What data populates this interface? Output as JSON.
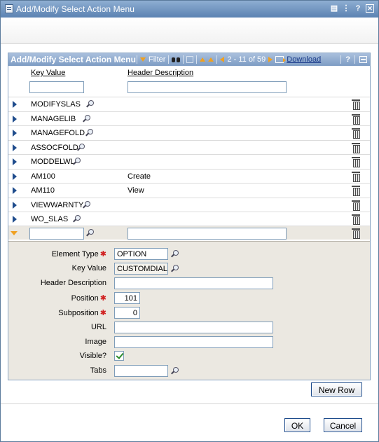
{
  "window": {
    "title": "Add/Modify Select Action Menu",
    "controls": [
      "▤",
      "⋮",
      "?",
      "✕"
    ]
  },
  "panel": {
    "title": "Add/Modify Select Action Menu",
    "filter_label": "Filter",
    "range_text": "2 - 11 of 59",
    "download_label": "Download",
    "help_label": "?"
  },
  "columns": {
    "key_value": "Key Value",
    "header_description": "Header Description"
  },
  "rows": [
    {
      "key": "MODIFYSLAS",
      "desc": "",
      "lookup": true
    },
    {
      "key": "MANAGELIB",
      "desc": "",
      "lookup": true
    },
    {
      "key": "MANAGEFOLD",
      "desc": "",
      "lookup": true
    },
    {
      "key": "ASSOCFOLD",
      "desc": "",
      "lookup": true
    },
    {
      "key": "MODDELWL",
      "desc": "",
      "lookup": true
    },
    {
      "key": "AM100",
      "desc": "Create",
      "lookup": false
    },
    {
      "key": "AM110",
      "desc": "View",
      "lookup": false
    },
    {
      "key": "VIEWWARNTY",
      "desc": "",
      "lookup": true
    },
    {
      "key": "WO_SLAS",
      "desc": "",
      "lookup": true
    }
  ],
  "detail": {
    "element_type_label": "Element Type",
    "element_type_value": "OPTION",
    "key_value_label": "Key Value",
    "key_value_value": "CUSTOMDIAL",
    "header_description_label": "Header Description",
    "header_description_value": "",
    "position_label": "Position",
    "position_value": "101",
    "subposition_label": "Subposition",
    "subposition_value": "0",
    "url_label": "URL",
    "url_value": "",
    "image_label": "Image",
    "image_value": "",
    "visible_label": "Visible?",
    "visible_checked": true,
    "tabs_label": "Tabs",
    "tabs_value": ""
  },
  "buttons": {
    "new_row": "New Row",
    "ok": "OK",
    "cancel": "Cancel"
  }
}
